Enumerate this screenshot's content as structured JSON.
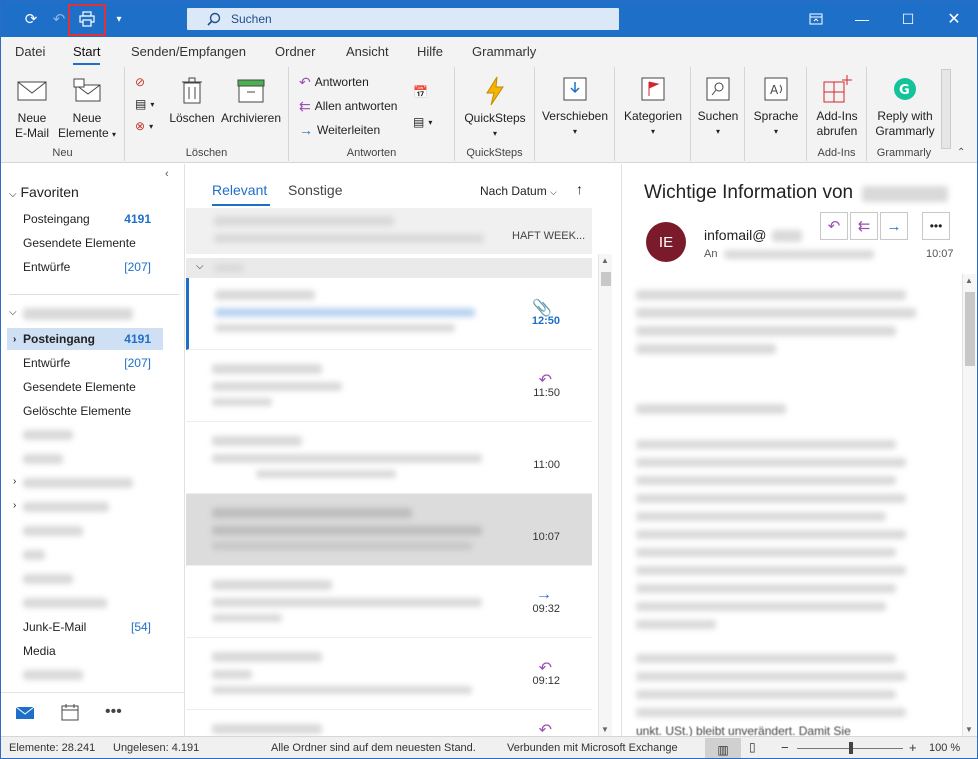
{
  "titlebar": {
    "search_placeholder": "Suchen"
  },
  "menu": {
    "tabs": [
      "Datei",
      "Start",
      "Senden/Empfangen",
      "Ordner",
      "Ansicht",
      "Hilfe",
      "Grammarly"
    ],
    "active": "Start"
  },
  "ribbon": {
    "groups": {
      "neu": "Neu",
      "loeschen": "Löschen",
      "antworten": "Antworten",
      "quicksteps": "QuickSteps",
      "addins": "Add-Ins",
      "grammarly": "Grammarly"
    },
    "new_email": "Neue E-Mail",
    "new_email_l1": "Neue",
    "new_email_l2": "E-Mail",
    "new_items_l1": "Neue",
    "new_items_l2": "Elemente",
    "delete": "Löschen",
    "archive": "Archivieren",
    "reply": "Antworten",
    "reply_all": "Allen antworten",
    "forward": "Weiterleiten",
    "quicksteps_btn": "QuickSteps",
    "move": "Verschieben",
    "categories": "Kategorien",
    "search": "Suchen",
    "language": "Sprache",
    "addins_l1": "Add-Ins",
    "addins_l2": "abrufen",
    "grammarly_l1": "Reply with",
    "grammarly_l2": "Grammarly"
  },
  "folders": {
    "favorites_header": "Favoriten",
    "favorites": [
      {
        "name": "Posteingang",
        "count": "4191"
      },
      {
        "name": "Gesendete Elemente",
        "count": ""
      },
      {
        "name": "Entwürfe",
        "count": "[207]"
      }
    ],
    "account": [
      {
        "name": "Posteingang",
        "count": "4191"
      },
      {
        "name": "Entwürfe",
        "count": "[207]"
      },
      {
        "name": "Gesendete Elemente",
        "count": ""
      },
      {
        "name": "Gelöschte Elemente",
        "count": ""
      }
    ],
    "junk": {
      "name": "Junk-E-Mail",
      "count": "[54]"
    },
    "media": "Media"
  },
  "list": {
    "tab_relevant": "Relevant",
    "tab_other": "Sonstige",
    "sort": "Nach Datum",
    "first_preview_tail": "HAFT WEEK...",
    "messages": [
      {
        "time": "12:50",
        "unread": true,
        "icon": "paperclip-icon"
      },
      {
        "time": "11:50",
        "unread": false,
        "icon": "reply-icon"
      },
      {
        "time": "11:00",
        "unread": false,
        "icon": ""
      },
      {
        "time": "10:07",
        "unread": false,
        "icon": ""
      },
      {
        "time": "09:32",
        "unread": false,
        "icon": "forward-icon"
      },
      {
        "time": "09:12",
        "unread": false,
        "icon": "reply-icon"
      }
    ]
  },
  "reading": {
    "subject": "Wichtige Information von",
    "avatar": "IE",
    "sender": "infomail@",
    "to_label": "An",
    "time": "10:07",
    "body_tail": "unkt. USt.) bleibt unverändert. Damit Sie"
  },
  "status": {
    "items": "Elemente: 28.241",
    "unread": "Ungelesen: 4.191",
    "sync": "Alle Ordner sind auf dem neuesten Stand.",
    "connection": "Verbunden mit Microsoft Exchange",
    "zoom": "100 %"
  },
  "colors": {
    "accent": "#1e6fc8",
    "avatar": "#7a1a2a",
    "highlight": "#e0303a",
    "reply_purple": "#9b4fb5"
  }
}
